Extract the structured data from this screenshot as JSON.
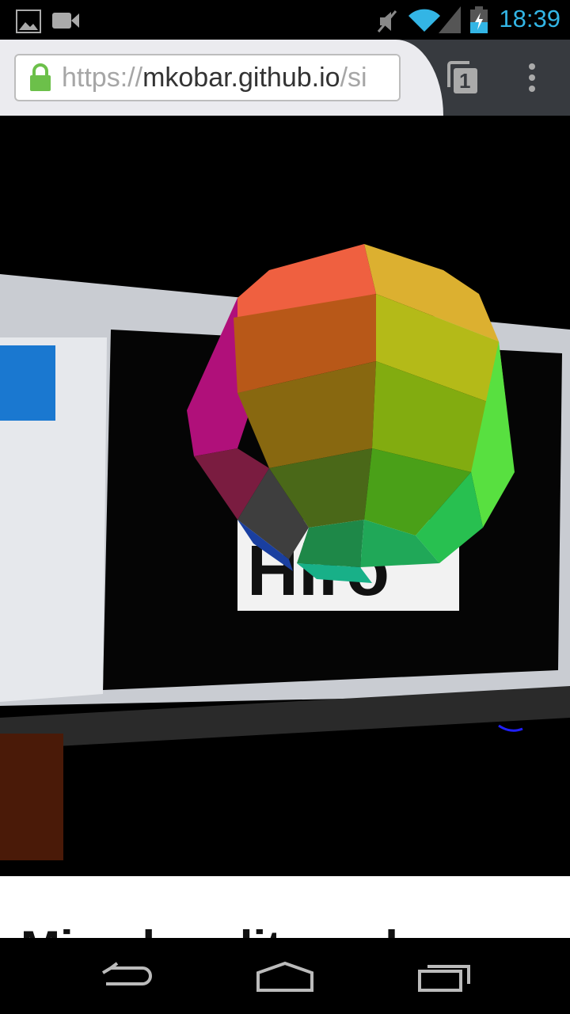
{
  "status_bar": {
    "time": "18:39",
    "icons": [
      "gallery-icon",
      "video-icon",
      "mute-icon",
      "wifi-icon",
      "signal-icon",
      "battery-charging-icon"
    ],
    "accent": "#33b5e5"
  },
  "browser": {
    "url_scheme": "https://",
    "url_host": "mkobar.github.io",
    "url_path": "/si",
    "tab_count": "1",
    "lock_color": "#6cc04a"
  },
  "page": {
    "heading": "Mixed reality web"
  },
  "camera": {
    "marker_text": "Hiro"
  },
  "nav_bar": {
    "icons": [
      "back-icon",
      "home-icon",
      "recents-icon"
    ]
  }
}
